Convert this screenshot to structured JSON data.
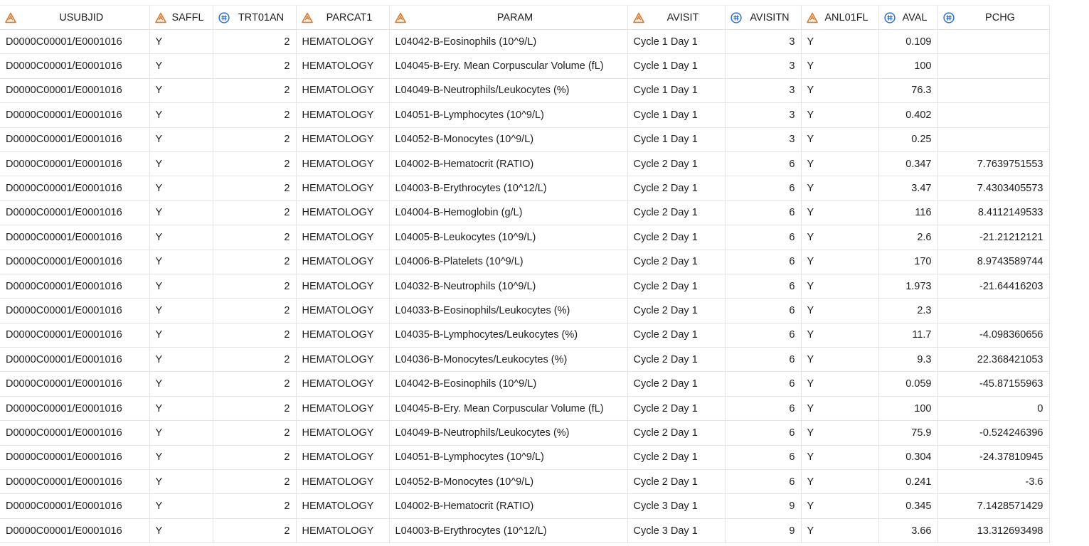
{
  "colors": {
    "char_icon": "#d97a2b",
    "num_icon": "#2f6fd6",
    "grid_line": "#e4e4e4"
  },
  "columns": [
    {
      "key": "USUBJID",
      "label": "USUBJID",
      "type": "char",
      "icon": "triangle-icon"
    },
    {
      "key": "SAFFL",
      "label": "SAFFL",
      "type": "char",
      "icon": "triangle-icon"
    },
    {
      "key": "TRT01AN",
      "label": "TRT01AN",
      "type": "num",
      "icon": "hash-icon"
    },
    {
      "key": "PARCAT1",
      "label": "PARCAT1",
      "type": "char",
      "icon": "triangle-icon"
    },
    {
      "key": "PARAM",
      "label": "PARAM",
      "type": "char",
      "icon": "triangle-icon"
    },
    {
      "key": "AVISIT",
      "label": "AVISIT",
      "type": "char",
      "icon": "triangle-icon"
    },
    {
      "key": "AVISITN",
      "label": "AVISITN",
      "type": "num",
      "icon": "hash-icon"
    },
    {
      "key": "ANL01FL",
      "label": "ANL01FL",
      "type": "char",
      "icon": "triangle-icon"
    },
    {
      "key": "AVAL",
      "label": "AVAL",
      "type": "num",
      "icon": "hash-icon"
    },
    {
      "key": "PCHG",
      "label": "PCHG",
      "type": "num",
      "icon": "hash-icon"
    }
  ],
  "rows": [
    [
      "D0000C00001/E0001016",
      "Y",
      "2",
      "HEMATOLOGY",
      "L04042-B-Eosinophils (10^9/L)",
      "Cycle 1 Day 1",
      "3",
      "Y",
      "0.109",
      ""
    ],
    [
      "D0000C00001/E0001016",
      "Y",
      "2",
      "HEMATOLOGY",
      "L04045-B-Ery. Mean Corpuscular Volume (fL)",
      "Cycle 1 Day 1",
      "3",
      "Y",
      "100",
      ""
    ],
    [
      "D0000C00001/E0001016",
      "Y",
      "2",
      "HEMATOLOGY",
      "L04049-B-Neutrophils/Leukocytes (%)",
      "Cycle 1 Day 1",
      "3",
      "Y",
      "76.3",
      ""
    ],
    [
      "D0000C00001/E0001016",
      "Y",
      "2",
      "HEMATOLOGY",
      "L04051-B-Lymphocytes (10^9/L)",
      "Cycle 1 Day 1",
      "3",
      "Y",
      "0.402",
      ""
    ],
    [
      "D0000C00001/E0001016",
      "Y",
      "2",
      "HEMATOLOGY",
      "L04052-B-Monocytes (10^9/L)",
      "Cycle 1 Day 1",
      "3",
      "Y",
      "0.25",
      ""
    ],
    [
      "D0000C00001/E0001016",
      "Y",
      "2",
      "HEMATOLOGY",
      "L04002-B-Hematocrit (RATIO)",
      "Cycle 2 Day 1",
      "6",
      "Y",
      "0.347",
      "7.7639751553"
    ],
    [
      "D0000C00001/E0001016",
      "Y",
      "2",
      "HEMATOLOGY",
      "L04003-B-Erythrocytes (10^12/L)",
      "Cycle 2 Day 1",
      "6",
      "Y",
      "3.47",
      "7.4303405573"
    ],
    [
      "D0000C00001/E0001016",
      "Y",
      "2",
      "HEMATOLOGY",
      "L04004-B-Hemoglobin (g/L)",
      "Cycle 2 Day 1",
      "6",
      "Y",
      "116",
      "8.4112149533"
    ],
    [
      "D0000C00001/E0001016",
      "Y",
      "2",
      "HEMATOLOGY",
      "L04005-B-Leukocytes (10^9/L)",
      "Cycle 2 Day 1",
      "6",
      "Y",
      "2.6",
      "-21.21212121"
    ],
    [
      "D0000C00001/E0001016",
      "Y",
      "2",
      "HEMATOLOGY",
      "L04006-B-Platelets (10^9/L)",
      "Cycle 2 Day 1",
      "6",
      "Y",
      "170",
      "8.9743589744"
    ],
    [
      "D0000C00001/E0001016",
      "Y",
      "2",
      "HEMATOLOGY",
      "L04032-B-Neutrophils (10^9/L)",
      "Cycle 2 Day 1",
      "6",
      "Y",
      "1.973",
      "-21.64416203"
    ],
    [
      "D0000C00001/E0001016",
      "Y",
      "2",
      "HEMATOLOGY",
      "L04033-B-Eosinophils/Leukocytes (%)",
      "Cycle 2 Day 1",
      "6",
      "Y",
      "2.3",
      ""
    ],
    [
      "D0000C00001/E0001016",
      "Y",
      "2",
      "HEMATOLOGY",
      "L04035-B-Lymphocytes/Leukocytes (%)",
      "Cycle 2 Day 1",
      "6",
      "Y",
      "11.7",
      "-4.098360656"
    ],
    [
      "D0000C00001/E0001016",
      "Y",
      "2",
      "HEMATOLOGY",
      "L04036-B-Monocytes/Leukocytes (%)",
      "Cycle 2 Day 1",
      "6",
      "Y",
      "9.3",
      "22.368421053"
    ],
    [
      "D0000C00001/E0001016",
      "Y",
      "2",
      "HEMATOLOGY",
      "L04042-B-Eosinophils (10^9/L)",
      "Cycle 2 Day 1",
      "6",
      "Y",
      "0.059",
      "-45.87155963"
    ],
    [
      "D0000C00001/E0001016",
      "Y",
      "2",
      "HEMATOLOGY",
      "L04045-B-Ery. Mean Corpuscular Volume (fL)",
      "Cycle 2 Day 1",
      "6",
      "Y",
      "100",
      "0"
    ],
    [
      "D0000C00001/E0001016",
      "Y",
      "2",
      "HEMATOLOGY",
      "L04049-B-Neutrophils/Leukocytes (%)",
      "Cycle 2 Day 1",
      "6",
      "Y",
      "75.9",
      "-0.524246396"
    ],
    [
      "D0000C00001/E0001016",
      "Y",
      "2",
      "HEMATOLOGY",
      "L04051-B-Lymphocytes (10^9/L)",
      "Cycle 2 Day 1",
      "6",
      "Y",
      "0.304",
      "-24.37810945"
    ],
    [
      "D0000C00001/E0001016",
      "Y",
      "2",
      "HEMATOLOGY",
      "L04052-B-Monocytes (10^9/L)",
      "Cycle 2 Day 1",
      "6",
      "Y",
      "0.241",
      "-3.6"
    ],
    [
      "D0000C00001/E0001016",
      "Y",
      "2",
      "HEMATOLOGY",
      "L04002-B-Hematocrit (RATIO)",
      "Cycle 3 Day 1",
      "9",
      "Y",
      "0.345",
      "7.1428571429"
    ],
    [
      "D0000C00001/E0001016",
      "Y",
      "2",
      "HEMATOLOGY",
      "L04003-B-Erythrocytes (10^12/L)",
      "Cycle 3 Day 1",
      "9",
      "Y",
      "3.66",
      "13.312693498"
    ]
  ]
}
